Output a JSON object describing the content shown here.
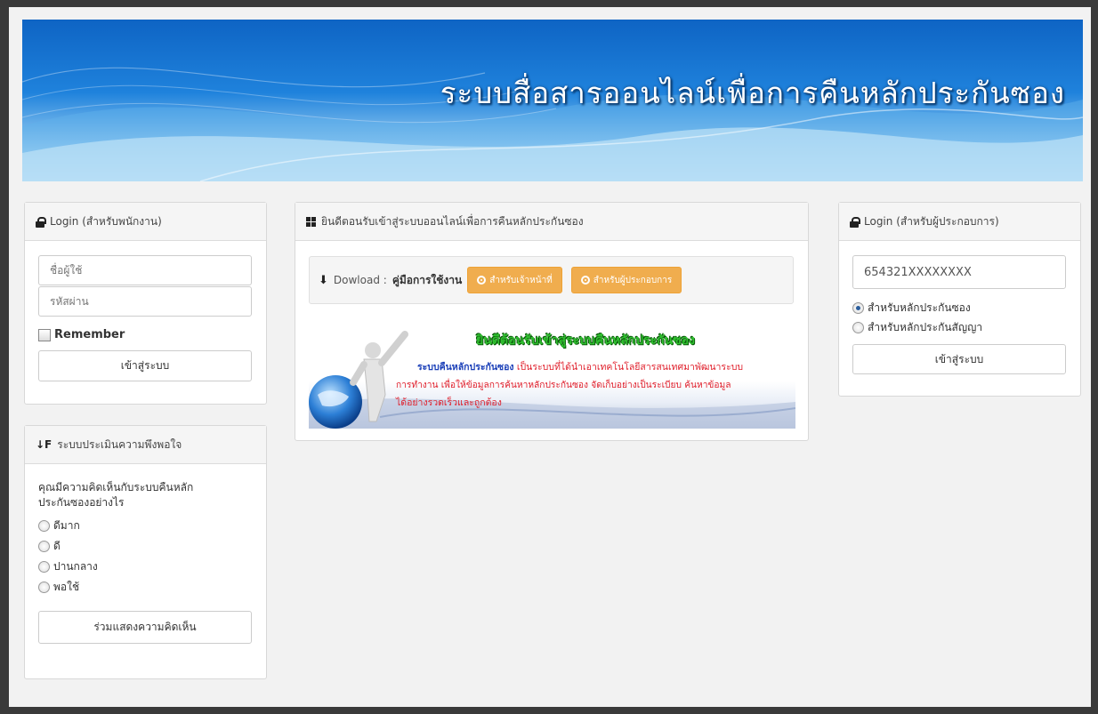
{
  "banner": {
    "title": "ระบบสื่อสารออนไลน์เพื่อการคืนหลักประกันซอง"
  },
  "staff_login": {
    "title": "Login (สำหรับพนักงาน)",
    "username_placeholder": "ชื่อผู้ใช้",
    "password_placeholder": "รหัสผ่าน",
    "remember_label": "Remember",
    "submit_label": "เข้าสู่ระบบ"
  },
  "survey": {
    "title": "ระบบประเมินความพึงพอใจ",
    "question": "คุณมีความคิดเห็นกับระบบคืนหลักประกันซองอย่างไร",
    "options": [
      "ดีมาก",
      "ดี",
      "ปานกลาง",
      "พอใช้"
    ],
    "submit_label": "ร่วมแสดงความคิดเห็น"
  },
  "welcome": {
    "title": "ยินดีตอนรับเข้าสู่ระบบออนไลน์เพื่อการคืนหลักประกันซอง",
    "download_label": "Dowload :",
    "manual_label": "คู่มือการใช้งาน",
    "staff_manual_button": "สำหรับเจ้าหน้าที่",
    "operator_manual_button": "สำหรับผู้ประกอบการ",
    "image": {
      "headline": "ยินดีต้อนรับเข้าสู่ระบบคืนหลักประกันซอง",
      "system_name": "ระบบคืนหลักประกันซอง",
      "line1": "เป็นระบบที่ได้นำเอาเทคโนโลยีสารสนเทศมาพัฒนาระบบ",
      "line2": "การทำงาน เพื่อให้ข้อมูลการค้นหาหลักประกันซอง จัดเก็บอย่างเป็นระเบียบ ค้นหาข้อมูล",
      "line3": "ได้อย่างรวดเร็วและถูกต้อง"
    }
  },
  "operator_login": {
    "title": "Login (สำหรับผู้ประกอบการ)",
    "id_value": "654321XXXXXXXX",
    "options": [
      "สำหรับหลักประกันซอง",
      "สำหรับหลักประกันสัญญา"
    ],
    "submit_label": "เข้าสู่ระบบ"
  },
  "colors": {
    "accent_orange": "#f0ad4e",
    "banner_blue": "#1f82dc",
    "headline_green": "#2fbf2f",
    "body_red": "#e0202c",
    "system_blue": "#1a3fb8"
  }
}
